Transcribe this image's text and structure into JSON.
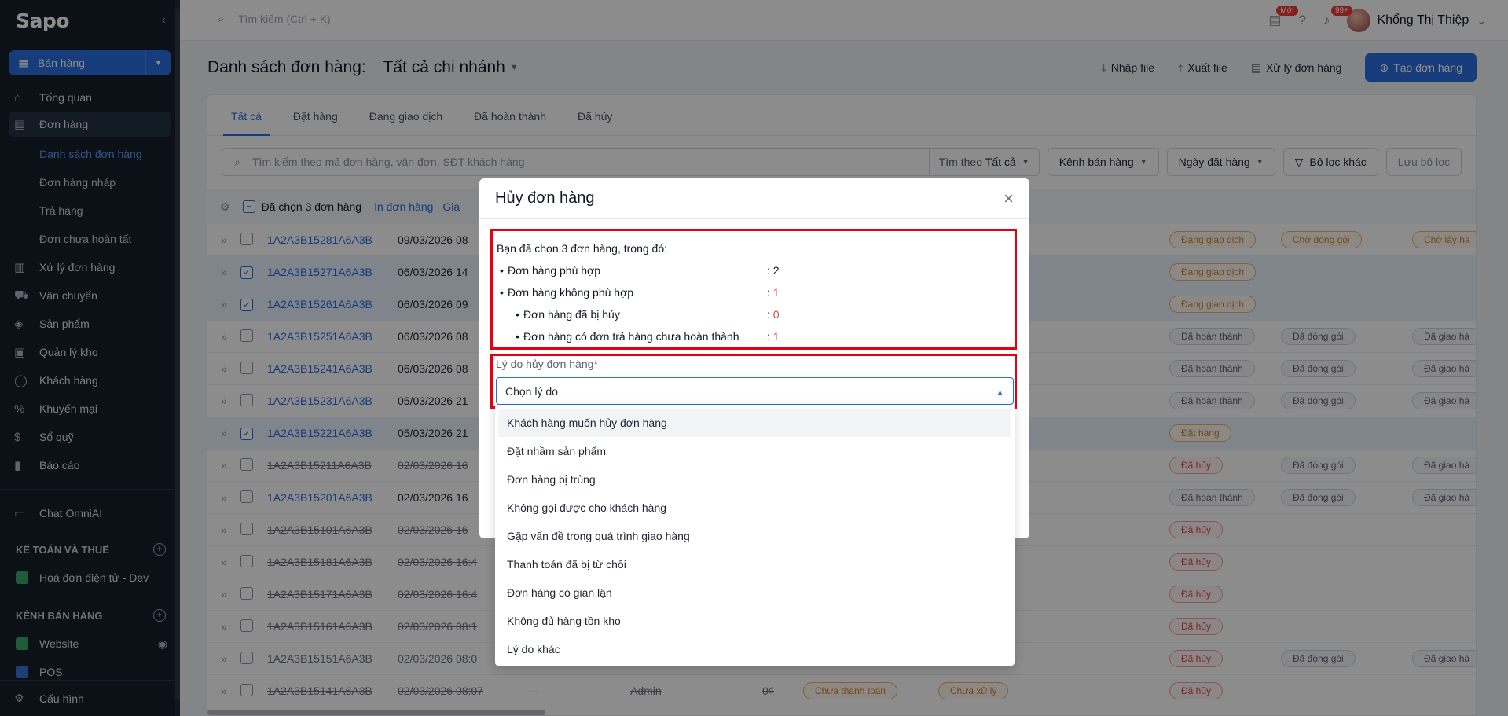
{
  "app": {
    "logo": "Sapo",
    "sale_button": "Bán hàng"
  },
  "sidebar": {
    "items": [
      {
        "label": "Tổng quan",
        "icon": "home-icon"
      },
      {
        "label": "Đơn hàng",
        "icon": "receipt-icon"
      },
      {
        "label": "Xử lý đơn hàng",
        "icon": "clipboard-icon"
      },
      {
        "label": "Vận chuyển",
        "icon": "truck-icon"
      },
      {
        "label": "Sản phẩm",
        "icon": "box-icon"
      },
      {
        "label": "Quản lý kho",
        "icon": "warehouse-icon"
      },
      {
        "label": "Khách hàng",
        "icon": "user-icon"
      },
      {
        "label": "Khuyến mại",
        "icon": "percent-icon"
      },
      {
        "label": "Sổ quỹ",
        "icon": "wallet-icon"
      },
      {
        "label": "Báo cáo",
        "icon": "chart-icon"
      },
      {
        "label": "Chat OmniAI",
        "icon": "chat-icon"
      }
    ],
    "subitems": [
      "Danh sách đơn hàng",
      "Đơn hàng nháp",
      "Trả hàng",
      "Đơn chưa hoàn tất"
    ],
    "section_accounting": "KẾ TOÁN VÀ THUẾ",
    "einvoice": "Hoá đơn điện tử - Dev",
    "section_channels": "KÊNH BÁN HÀNG",
    "website": "Website",
    "pos": "POS",
    "config": "Cấu hình"
  },
  "topbar": {
    "search_placeholder": "Tìm kiếm (Ctrl + K)",
    "new_badge": "Mới",
    "notif_badge": "99+",
    "user_name": "Khổng Thị Thiệp"
  },
  "page": {
    "title": "Danh sách đơn hàng:",
    "branch": "Tất cả chi nhánh",
    "import": "Nhập file",
    "export": "Xuất file",
    "process": "Xử lý đơn hàng",
    "create": "Tạo đơn hàng"
  },
  "tabs": [
    "Tất cả",
    "Đặt hàng",
    "Đang giao dịch",
    "Đã hoàn thành",
    "Đã hủy"
  ],
  "filters": {
    "search_placeholder": "Tìm kiếm theo mã đơn hàng, vận đơn, SĐT khách hàng",
    "search_by": "Tìm theo",
    "search_by_value": "Tất cả",
    "channel": "Kênh bán hàng",
    "date": "Ngày đặt hàng",
    "other": "Bộ lọc khác",
    "save": "Lưu bộ lọc"
  },
  "bulk": {
    "selected": "Đã chọn 3 đơn hàng",
    "print": "In đơn hàng",
    "more": "Gia"
  },
  "rows": [
    {
      "code": "1A2A3B15281A6A3B",
      "date": "09/03/2026 08",
      "sel": false,
      "cancel": false,
      "p1": [
        "Đang giao dịch",
        "orange"
      ],
      "p2": [
        "Chờ đóng gói",
        "orange"
      ],
      "p3": [
        "Chờ lấy hà",
        "orange"
      ]
    },
    {
      "code": "1A2A3B15271A6A3B",
      "date": "06/03/2026 14",
      "sel": true,
      "cancel": false,
      "p1": [
        "Đang giao dịch",
        "orange"
      ],
      "p2": null,
      "p3": null
    },
    {
      "code": "1A2A3B15261A6A3B",
      "date": "06/03/2026 09",
      "sel": true,
      "cancel": false,
      "p1": [
        "Đang giao dịch",
        "orange"
      ],
      "p2": null,
      "p3": null
    },
    {
      "code": "1A2A3B15251A6A3B",
      "date": "06/03/2026 08",
      "sel": false,
      "cancel": false,
      "p1": [
        "Đã hoàn thành",
        "gray"
      ],
      "p2": [
        "Đã đóng gói",
        "gray"
      ],
      "p3": [
        "Đã giao hà",
        "gray"
      ]
    },
    {
      "code": "1A2A3B15241A6A3B",
      "date": "06/03/2026 08",
      "sel": false,
      "cancel": false,
      "p1": [
        "Đã hoàn thành",
        "gray"
      ],
      "p2": [
        "Đã đóng gói",
        "gray"
      ],
      "p3": [
        "Đã giao hà",
        "gray"
      ]
    },
    {
      "code": "1A2A3B15231A6A3B",
      "date": "05/03/2026 21",
      "sel": false,
      "cancel": false,
      "p1": [
        "Đã hoàn thành",
        "gray"
      ],
      "p2": [
        "Đã đóng gói",
        "gray"
      ],
      "p3": [
        "Đã giao hà",
        "gray"
      ]
    },
    {
      "code": "1A2A3B15221A6A3B",
      "date": "05/03/2026 21",
      "sel": true,
      "cancel": false,
      "p1": [
        "Đặt hàng",
        "orange"
      ],
      "p2": null,
      "p3": null
    },
    {
      "code": "1A2A3B15211A6A3B",
      "date": "02/03/2026 16",
      "sel": false,
      "cancel": true,
      "p1": [
        "Đã hủy",
        "red"
      ],
      "p2": [
        "Đã đóng gói",
        "gray"
      ],
      "p3": [
        "Đã giao hà",
        "gray"
      ]
    },
    {
      "code": "1A2A3B15201A6A3B",
      "date": "02/03/2026 16",
      "sel": false,
      "cancel": false,
      "dim": true,
      "p1": [
        "Đã hoàn thành",
        "gray"
      ],
      "p2": [
        "Đã đóng gói",
        "gray"
      ],
      "p3": [
        "Đã giao hà",
        "gray"
      ]
    },
    {
      "code": "1A2A3B15101A6A3B",
      "date": "02/03/2026 16",
      "sel": false,
      "cancel": true,
      "p1": [
        "Đã hủy",
        "red"
      ],
      "p2": null,
      "p3": null
    },
    {
      "code": "1A2A3B15181A6A3B",
      "date": "02/03/2026 16:4",
      "sel": false,
      "cancel": true,
      "p1": [
        "Đã hủy",
        "red"
      ],
      "p2": null,
      "p3": null
    },
    {
      "code": "1A2A3B15171A6A3B",
      "date": "02/03/2026 16:4",
      "sel": false,
      "cancel": true,
      "p1": [
        "Đã hủy",
        "red"
      ],
      "p2": null,
      "p3": null
    },
    {
      "code": "1A2A3B15161A6A3B",
      "date": "02/03/2026 08:1",
      "sel": false,
      "cancel": true,
      "p1": [
        "Đã hủy",
        "red"
      ],
      "p2": null,
      "p3": null
    },
    {
      "code": "1A2A3B15151A6A3B",
      "date": "02/03/2026 08:0",
      "sel": false,
      "cancel": true,
      "p1": [
        "Đã hủy",
        "red"
      ],
      "p2": [
        "Đã đóng gói",
        "gray"
      ],
      "p3": [
        "Đã giao hà",
        "gray"
      ]
    },
    {
      "code": "1A2A3B15141A6A3B",
      "date": "02/03/2026 08:07",
      "sel": false,
      "cancel": true,
      "p1": [
        "Đã hủy",
        "red"
      ],
      "p2": null,
      "p3": null,
      "dashes": "---",
      "creator": "Admin",
      "amount": "0₫",
      "pay": "Chưa thanh toán",
      "proc": "Chưa xử lý"
    }
  ],
  "modal": {
    "title": "Hủy đơn hàng",
    "summary": "Bạn đã chọn 3 đơn hàng, trong đó:",
    "fit_label": "Đơn hàng phù hợp",
    "fit_value": ": 2",
    "unfit_label": "Đơn hàng không phù hợp",
    "unfit_value": ": 1",
    "cancelled_label": "Đơn hàng đã bị hủy",
    "cancelled_value": ": 0",
    "return_label": "Đơn hàng có đơn trả hàng chưa hoàn thành",
    "return_value": ": 1",
    "reason_label": "Lý do hủy đơn hàng",
    "reason_required": "*",
    "reason_placeholder": "Chọn lý do",
    "options": [
      "Khách hàng muốn hủy đơn hàng",
      "Đặt nhầm sản phẩm",
      "Đơn hàng bị trùng",
      "Không gọi được cho khách hàng",
      "Gặp vấn đề trong quá trình giao hàng",
      "Thanh toán đã bị từ chối",
      "Đơn hàng có gian lận",
      "Không đủ hàng tồn kho",
      "Lý do khác"
    ]
  },
  "colors": {
    "primary": "#2a6ee0",
    "sidebar_bg": "#16202c",
    "highlight_border": "#e60012",
    "danger": "#e04747"
  }
}
